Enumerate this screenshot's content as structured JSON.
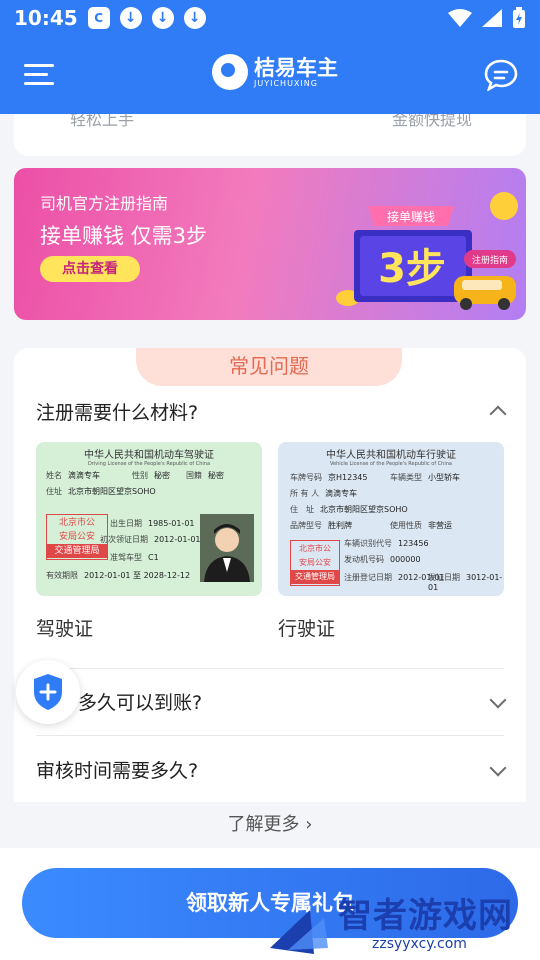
{
  "status_bar": {
    "time": "10:45",
    "app_badge": "C"
  },
  "header": {
    "title": "桔易车主",
    "subtitle": "JUYICHUXING"
  },
  "prev_card": {
    "left_text": "轻松上手",
    "right_text": "金额快提现"
  },
  "banner": {
    "subtitle": "司机官方注册指南",
    "title": "接单赚钱 仅需3步",
    "button_label": "点击查看",
    "art_ribbon": "接单赚钱",
    "art_big": "3步",
    "art_tag": "注册指南"
  },
  "faq": {
    "tab_title": "常见问题",
    "q1": "注册需要什么材料?",
    "q2": "多久可以到账?",
    "q3": "审核时间需要多久?",
    "more_label": "了解更多"
  },
  "licenses": {
    "driver": {
      "caption": "驾驶证",
      "header": "中华人民共和国机动车驾驶证",
      "header_en": "Driving License of the People's Republic of China",
      "name_label": "姓名",
      "name": "滴滴专车",
      "sex_label": "性别",
      "sex": "秘密",
      "nation_label": "国籍",
      "nation": "秘密",
      "addr_label": "住址",
      "addr": "北京市朝阳区望京SOHO",
      "birth_label": "出生日期",
      "birth": "1985-01-01",
      "first_label": "初次领证日期",
      "first": "2012-01-01",
      "class_label": "准驾车型",
      "class": "C1",
      "valid_label": "有效期限",
      "valid": "2012-01-01 至 2028-12-12",
      "stamp1": "北京市公",
      "stamp2": "安局公安",
      "stamp3": "交通管理局"
    },
    "vehicle": {
      "caption": "行驶证",
      "header": "中华人民共和国机动车行驶证",
      "header_en": "Vehicle License of the People's Republic of China",
      "plate_label": "车牌号码",
      "plate": "京H12345",
      "type_label": "车辆类型",
      "type": "小型轿车",
      "owner_label": "所 有 人",
      "owner": "滴滴专车",
      "addr_label": "住　址",
      "addr": "北京市朝阳区望京SOHO",
      "model_label": "品牌型号",
      "model": "胜利牌",
      "use_label": "使用性质",
      "use": "非营运",
      "vin_label": "车辆识别代号",
      "vin": "123456",
      "engine_label": "发动机号码",
      "engine": "000000",
      "reg_label": "注册登记日期",
      "reg": "2012-01-01",
      "issue_label": "发证日期",
      "issue": "3012-01-01",
      "stamp1": "北京市公",
      "stamp2": "安局公安",
      "stamp3": "交通管理局"
    }
  },
  "cta": {
    "label": "领取新人专属礼包"
  },
  "watermark": {
    "text": "智者游戏网",
    "url": "zzsyyxcy.com"
  },
  "colors": {
    "primary": "#2f7cf6",
    "accent": "#e56a52",
    "banner_pink": "#ec4fa6"
  }
}
